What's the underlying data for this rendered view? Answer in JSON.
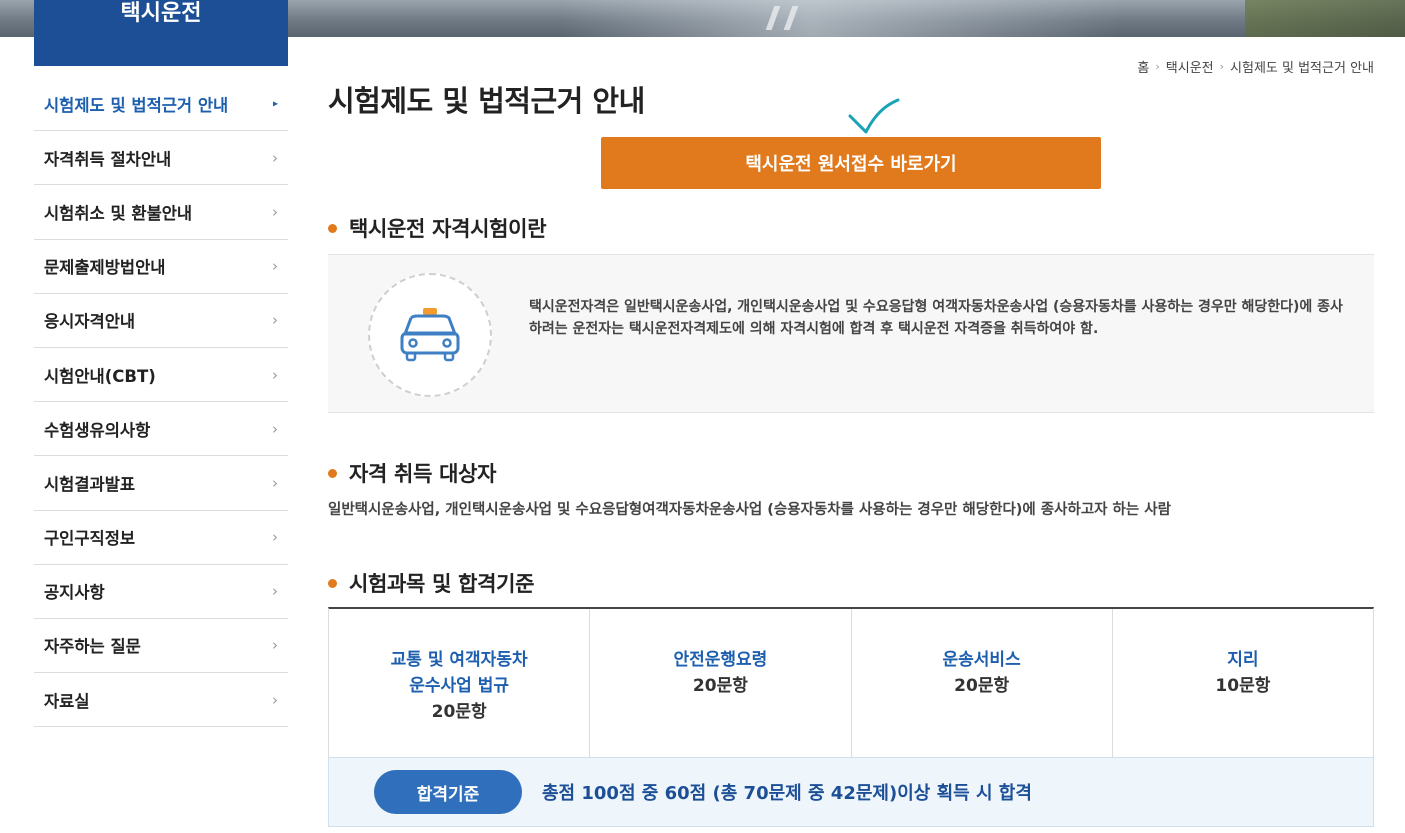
{
  "sidebar": {
    "title": "택시운전",
    "items": [
      {
        "label": "시험제도 및 법적근거 안내",
        "active": true
      },
      {
        "label": "자격취득 절차안내"
      },
      {
        "label": "시험취소 및 환불안내"
      },
      {
        "label": "문제출제방법안내"
      },
      {
        "label": "응시자격안내"
      },
      {
        "label": "시험안내(CBT)"
      },
      {
        "label": "수험생유의사항"
      },
      {
        "label": "시험결과발표"
      },
      {
        "label": "구인구직정보"
      },
      {
        "label": "공지사항"
      },
      {
        "label": "자주하는 질문"
      },
      {
        "label": "자료실"
      }
    ],
    "chevron": "›",
    "active_marker": "▸"
  },
  "breadcrumb": {
    "items": [
      "홈",
      "택시운전",
      "시험제도 및 법적근거 안내"
    ],
    "separator": "›"
  },
  "page": {
    "title": "시험제도 및 법적근거 안내",
    "apply_button": "택시운전 원서접수 바로가기"
  },
  "sections": {
    "about": {
      "title": "택시운전 자격시험이란",
      "text": "택시운전자격은 일반택시운송사업, 개인택시운송사업 및 수요응답형 여객자동차운송사업 (승용자동차를 사용하는 경우만 해당한다)에 종사하려는 운전자는 택시운전자격제도에 의해 자격시험에 합격 후 택시운전 자격증을 취득하여야 함.",
      "icon": "taxi-icon"
    },
    "target": {
      "title": "자격 취득 대상자",
      "text": "일반택시운송사업, 개인택시운송사업 및 수요응답형여객자동차운송사업 (승용자동차를 사용하는 경우만 해당한다)에 종사하고자 하는 사람"
    },
    "subjects": {
      "title": "시험과목 및 합격기준",
      "items": [
        {
          "name_line1": "교통 및 여객자동차",
          "name_line2": "운수사업 법규",
          "count": "20문항"
        },
        {
          "name_line1": "안전운행요령",
          "name_line2": "",
          "count": "20문항"
        },
        {
          "name_line1": "운송서비스",
          "name_line2": "",
          "count": "20문항"
        },
        {
          "name_line1": "지리",
          "name_line2": "",
          "count": "10문항"
        }
      ],
      "pass_label": "합격기준",
      "pass_text": "총점 100점 중 60점 (총 70문제 중 42문제)이상 획득 시 합격"
    }
  },
  "colors": {
    "primary": "#1d4f97",
    "accent": "#e07a1c",
    "link": "#1d5fae"
  }
}
